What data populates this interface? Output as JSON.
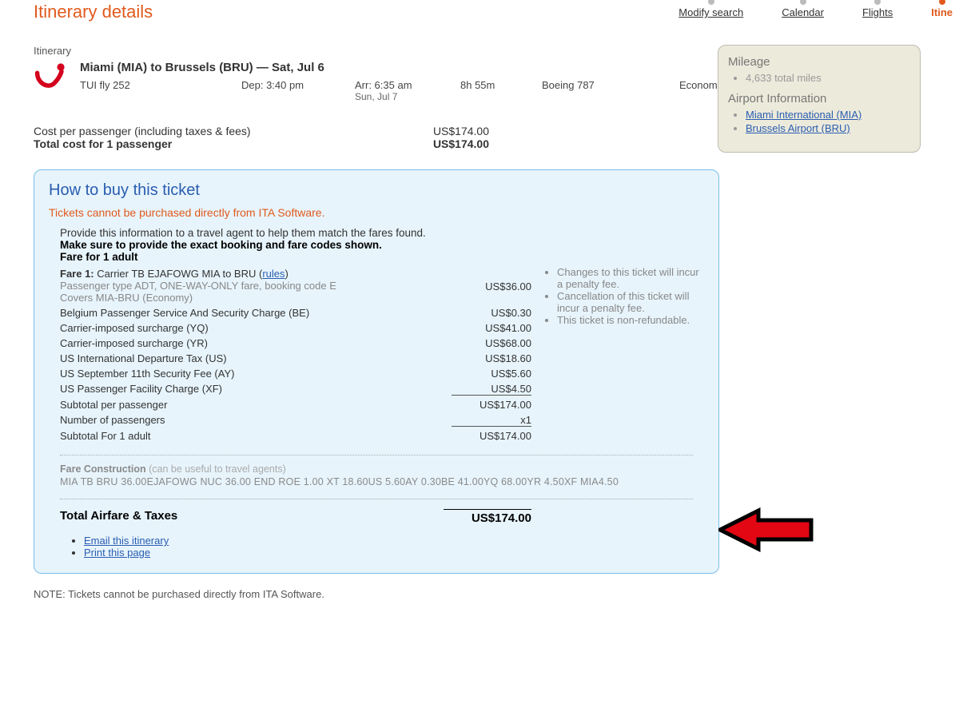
{
  "nav": {
    "modify": "Modify search",
    "calendar": "Calendar",
    "flights": "Flights",
    "itinerary": "Itine"
  },
  "title": "Itinerary details",
  "itinerary": {
    "label": "Itinerary",
    "route": "Miami (MIA) to Brussels (BRU) — Sat, Jul 6",
    "flight_no": "TUI fly 252",
    "dep": "Dep: 3:40 pm",
    "arr": "Arr: 6:35 am",
    "arr_sub": "Sun, Jul 7",
    "duration": "8h 55m",
    "equipment": "Boeing 787",
    "cabin": "Economy (E)"
  },
  "costs": {
    "per_pax_label": "Cost per passenger (including taxes & fees)",
    "per_pax_value": "US$174.00",
    "total_label": "Total cost for 1 passenger",
    "total_value": "US$174.00"
  },
  "side": {
    "mileage_title": "Mileage",
    "mileage_text": "4,633 total miles",
    "airport_title": "Airport Information",
    "airport1": "Miami International (MIA)",
    "airport2": "Brussels Airport (BRU)"
  },
  "buy": {
    "title": "How to buy this ticket",
    "warning": "Tickets cannot be purchased directly from ITA Software.",
    "instr1": "Provide this information to a travel agent to help them match the fares found.",
    "instr2": "Make sure to provide the exact booking and fare codes shown.",
    "fare_for": "Fare for 1 adult",
    "fare1_label": "Fare 1:",
    "fare1_text": " Carrier TB EJAFOWG MIA to BRU (",
    "rules": "rules",
    "fare1_close": ")",
    "fare1_sub1": "Passenger type ADT, ONE-WAY-ONLY fare, booking code E",
    "fare1_sub2": "Covers MIA-BRU (Economy)",
    "fare1_amt": "US$36.00",
    "rows": [
      {
        "desc": "Belgium Passenger Service And Security Charge (BE)",
        "amt": "US$0.30"
      },
      {
        "desc": "Carrier-imposed surcharge (YQ)",
        "amt": "US$41.00"
      },
      {
        "desc": "Carrier-imposed surcharge (YR)",
        "amt": "US$68.00"
      },
      {
        "desc": "US International Departure Tax (US)",
        "amt": "US$18.60"
      },
      {
        "desc": "US September 11th Security Fee (AY)",
        "amt": "US$5.60"
      },
      {
        "desc": "US Passenger Facility Charge (XF)",
        "amt": "US$4.50"
      }
    ],
    "subtotal_pax": {
      "desc": "Subtotal per passenger",
      "amt": "US$174.00"
    },
    "num_pax": {
      "desc": "Number of passengers",
      "amt": "x1"
    },
    "subtotal_adult": {
      "desc": "Subtotal For 1 adult",
      "amt": "US$174.00"
    },
    "rules_list": [
      "Changes to this ticket will incur a penalty fee.",
      "Cancellation of this ticket will incur a penalty fee.",
      "This ticket is non-refundable."
    ],
    "fc_title": "Fare Construction",
    "fc_note": " (can be useful to travel agents)",
    "fc_string": "MIA TB BRU 36.00EJAFOWG NUC 36.00 END ROE 1.00 XT 18.60US 5.60AY 0.30BE 41.00YQ 68.00YR 4.50XF MIA4.50",
    "total_label": "Total Airfare & Taxes",
    "total_value": "US$174.00",
    "action_email": "Email this itinerary",
    "action_print": "Print this page"
  },
  "footnote": "NOTE: Tickets cannot be purchased directly from ITA Software."
}
